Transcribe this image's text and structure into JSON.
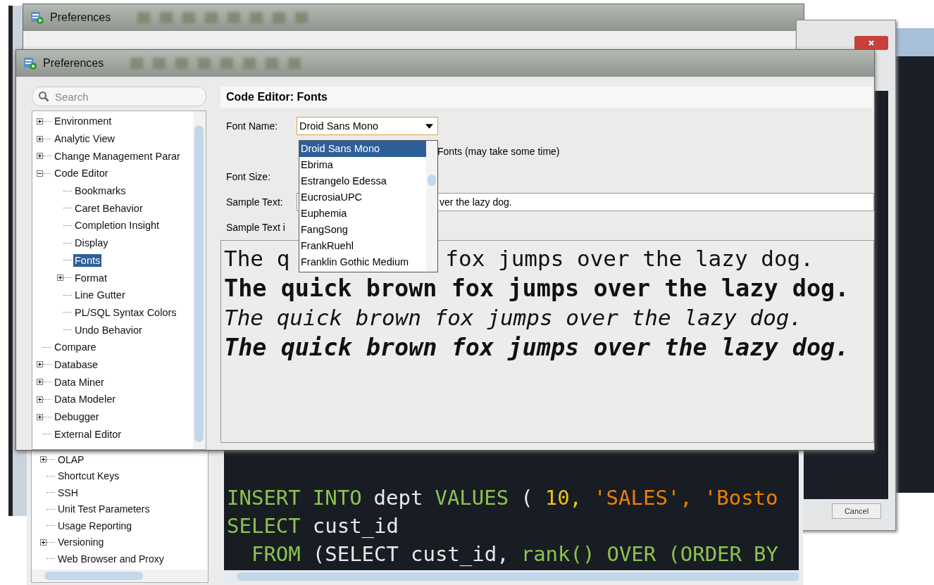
{
  "back_window": {
    "title": "Preferences"
  },
  "right_window": {
    "cancel_button": "Cancel"
  },
  "window": {
    "title": "Preferences"
  },
  "search": {
    "placeholder": "Search"
  },
  "tree": [
    {
      "label": "Environment",
      "expanded": false,
      "selected": false
    },
    {
      "label": "Analytic View",
      "expanded": false,
      "selected": false
    },
    {
      "label": "Change Management Parar",
      "expanded": false,
      "selected": false
    },
    {
      "label": "Code Editor",
      "expanded": true,
      "selected": false,
      "children": [
        {
          "label": "Bookmarks",
          "selected": false
        },
        {
          "label": "Caret Behavior",
          "selected": false
        },
        {
          "label": "Completion Insight",
          "selected": false
        },
        {
          "label": "Display",
          "selected": false
        },
        {
          "label": "Fonts",
          "selected": true
        },
        {
          "label": "Format",
          "expanded": false,
          "selected": false
        },
        {
          "label": "Line Gutter",
          "selected": false
        },
        {
          "label": "PL/SQL Syntax Colors",
          "selected": false
        },
        {
          "label": "Undo Behavior",
          "selected": false
        }
      ]
    },
    {
      "label": "Compare",
      "selected": false
    },
    {
      "label": "Database",
      "expanded": false,
      "selected": false
    },
    {
      "label": "Data Miner",
      "expanded": false,
      "selected": false
    },
    {
      "label": "Data Modeler",
      "expanded": false,
      "selected": false
    },
    {
      "label": "Debugger",
      "expanded": false,
      "selected": false
    },
    {
      "label": "External Editor",
      "selected": false
    }
  ],
  "panel": {
    "heading": "Code Editor: Fonts",
    "font_name_label": "Font Name:",
    "font_name_value": "Droid Sans Mono",
    "font_options": [
      {
        "label": "Droid Sans Mono",
        "selected": true
      },
      {
        "label": "Ebrima",
        "selected": false
      },
      {
        "label": "Estrangelo Edessa",
        "selected": false
      },
      {
        "label": "EucrosiaUPC",
        "selected": false
      },
      {
        "label": "Euphemia",
        "selected": false
      },
      {
        "label": "FangSong",
        "selected": false
      },
      {
        "label": "FrankRuehl",
        "selected": false
      },
      {
        "label": "Franklin Gothic Medium",
        "selected": false
      }
    ],
    "fonts_option_text": "Fonts (may take some time)",
    "font_size_label": "Font Size:",
    "sample_text_label": "Sample Text:",
    "sample_text_value": "ver the lazy dog.",
    "preview_label": "Sample Text i",
    "preview_lines": [
      {
        "kind": "regular",
        "parts": [
          "The q",
          "fox jumps over the lazy dog."
        ]
      },
      {
        "kind": "bold",
        "parts": [
          "The quick brown fox jumps over the lazy dog."
        ]
      },
      {
        "kind": "italic",
        "parts": [
          "The quick brown fox jumps over the lazy dog."
        ]
      },
      {
        "kind": "bold-italic",
        "parts": [
          "The quick brown fox jumps over the lazy dog."
        ]
      }
    ]
  },
  "bottom_window": {
    "tree": [
      {
        "label": "OLAP",
        "expanded": false
      },
      {
        "label": "Shortcut Keys"
      },
      {
        "label": "SSH"
      },
      {
        "label": "Unit Test Parameters"
      },
      {
        "label": "Usage Reporting"
      },
      {
        "label": "Versioning",
        "expanded": false
      },
      {
        "label": "Web Browser and Proxy"
      }
    ],
    "code_lines": [
      {
        "tokens": [
          {
            "kind": "keyword",
            "text": "INSERT"
          },
          {
            "kind": "keyword",
            "text": "INTO"
          },
          {
            "kind": "ident",
            "text": "dept"
          },
          {
            "kind": "keyword",
            "text": "VALUES"
          },
          {
            "kind": "ident",
            "text": "("
          },
          {
            "kind": "number",
            "text": "10,"
          },
          {
            "kind": "string",
            "text": "'SALES',"
          },
          {
            "kind": "string",
            "text": "'Bosto"
          }
        ]
      },
      {
        "tokens": [
          {
            "kind": "keyword",
            "text": "SELECT"
          },
          {
            "kind": "ident",
            "text": "cust_id"
          }
        ]
      },
      {
        "tokens": [
          {
            "kind": "keyword",
            "text": "  FROM"
          },
          {
            "kind": "ident",
            "text": "(SELECT"
          },
          {
            "kind": "ident",
            "text": "cust_id,"
          },
          {
            "kind": "keyword",
            "text": "rank()"
          },
          {
            "kind": "keyword",
            "text": "OVER"
          },
          {
            "kind": "keyword",
            "text": "(ORDER"
          },
          {
            "kind": "keyword",
            "text": "BY"
          }
        ]
      }
    ]
  }
}
